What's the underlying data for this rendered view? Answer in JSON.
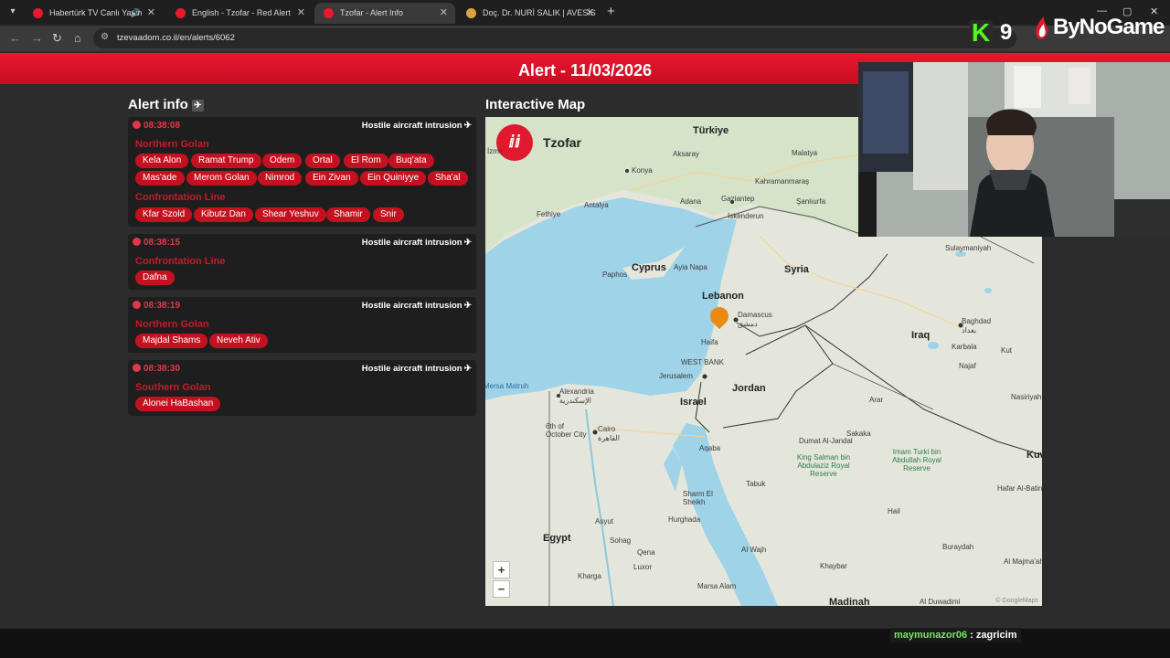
{
  "browser": {
    "tabs": [
      {
        "title": "Habertürk TV Canlı Yayın",
        "favicon_color": "#e8192c",
        "active": false
      },
      {
        "title": "English - Tzofar - Red Alert",
        "favicon_color": "#e8192c",
        "active": false
      },
      {
        "title": "Tzofar - Alert Info",
        "favicon_color": "#e8192c",
        "active": true
      },
      {
        "title": "Doç. Dr. NURİ SALIK | AVESİS",
        "favicon_color": "#d9a441",
        "active": false
      }
    ],
    "url": "tzevaadom.co.il/en/alerts/6062"
  },
  "overlay": {
    "kick_letter": "K",
    "kick_count": "9",
    "brand": "ByNoGame"
  },
  "page": {
    "banner_title": "Alert - 11/03/2026",
    "alert_info_title": "Alert info",
    "map_title": "Interactive Map"
  },
  "alerts": [
    {
      "time": "08:38:08",
      "type": "Hostile aircraft intrusion",
      "regions": [
        {
          "name": "Northern Golan",
          "places": [
            "Kela Alon",
            "Ramat Trump",
            "Odem",
            "Ortal",
            "El Rom",
            "Buq'ata",
            "Mas'ade",
            "Merom Golan",
            "Nimrod",
            "Ein Zivan",
            "Ein Quiniyye",
            "Sha'al"
          ]
        },
        {
          "name": "Confrontation Line",
          "places": [
            "Kfar Szold",
            "Kibutz Dan",
            "Shear Yeshuv",
            "Shamir",
            "Snir"
          ]
        }
      ]
    },
    {
      "time": "08:38:15",
      "type": "Hostile aircraft intrusion",
      "regions": [
        {
          "name": "Confrontation Line",
          "places": [
            "Dafna"
          ]
        }
      ]
    },
    {
      "time": "08:38:19",
      "type": "Hostile aircraft intrusion",
      "regions": [
        {
          "name": "Northern Golan",
          "places": [
            "Majdal Shams",
            "Neveh Ativ"
          ]
        }
      ]
    },
    {
      "time": "08:38:30",
      "type": "Hostile aircraft intrusion",
      "regions": [
        {
          "name": "Southern Golan",
          "places": [
            "Alonei HaBashan"
          ]
        }
      ]
    }
  ],
  "map": {
    "brand": "Tzofar",
    "zoom_in": "+",
    "zoom_out": "−",
    "attribution": "© GoogleMaps",
    "labels": {
      "turkiye": "Türkiye",
      "konya": "Konya",
      "aksaray": "Aksaray",
      "malatya": "Malatya",
      "kahramanmaras": "Kahramanmaraş",
      "antalya": "Antalya",
      "adana": "Adana",
      "gaziantep": "Gaziantep",
      "sanliurfa": "Şanlıurfa",
      "izmir": "İzmir",
      "fethiye": "Fethiye",
      "iskenderun": "İskenderun",
      "cyprus": "Cyprus",
      "paphos": "Paphos",
      "ayia_napa": "Ayia Napa",
      "syria": "Syria",
      "lebanon": "Lebanon",
      "damascus": "Damascus",
      "damascus_ar": "دمشق",
      "haifa": "Haifa",
      "west_bank": "WEST BANK",
      "jerusalem": "Jerusalem",
      "israel": "Israel",
      "jordan": "Jordan",
      "iraq": "Iraq",
      "baghdad": "Baghdad",
      "baghdad_ar": "بغداد",
      "karbala": "Karbala",
      "najaf": "Najaf",
      "kut": "Kut",
      "nasiriyah": "Nasiriyah",
      "sulaymaniyah": "Sulaymaniyah",
      "mersa_matruh": "Mersa Matruh",
      "alexandria": "Alexandria",
      "alexandria_ar": "الإسكندرية",
      "october_city": "6th of October City",
      "cairo": "Cairo",
      "cairo_ar": "القاهرة",
      "egypt": "Egypt",
      "aqaba": "Aqaba",
      "arar": "Arar",
      "dumat": "Dumat Al-Jandal",
      "sakaka": "Sakaka",
      "king_salman": "King Salman bin Abdulaziz Royal Reserve",
      "imam_turki": "Imam Turki bin Abdullah Royal Reserve",
      "tabuk": "Tabuk",
      "sharm": "Sharm El Sheikh",
      "hurghada": "Hurghada",
      "asyut": "Asyut",
      "sohag": "Sohag",
      "qena": "Qena",
      "luxor": "Luxor",
      "kharga": "Kharga",
      "marsa_alam": "Marsa Alam",
      "al_wajh": "Al Wajh",
      "khaybar": "Khaybar",
      "madinah": "Madinah",
      "hail": "Hail",
      "buraydah": "Buraydah",
      "al_majmaah": "Al Majma'ah",
      "al_duwadimi": "Al Duwadimi",
      "kuwait": "Kuw",
      "hafar": "Hafar Al-Batin"
    }
  },
  "chat": {
    "user": "maymunazor06",
    "message": " : zagricim"
  }
}
